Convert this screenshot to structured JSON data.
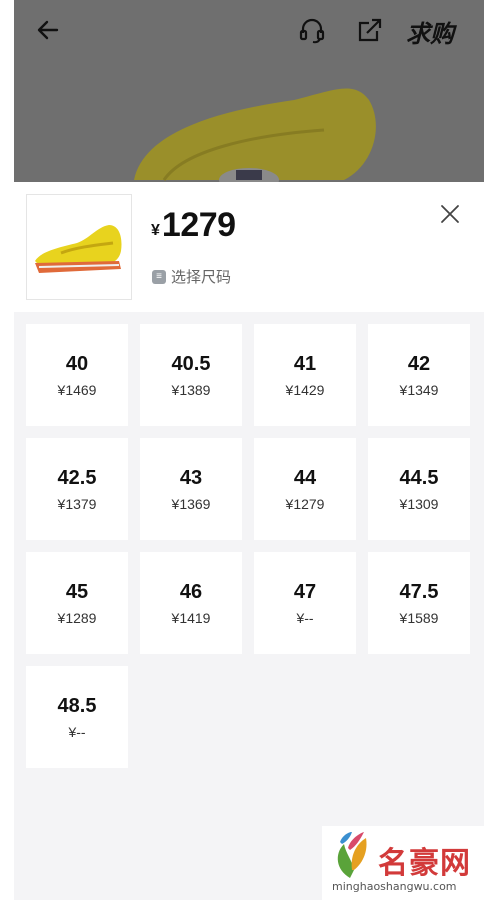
{
  "topbar": {
    "wanted_label": "求购"
  },
  "product": {
    "currency": "¥",
    "price": "1279",
    "select_hint": "选择尺码",
    "hint_icon_glyph": "≡"
  },
  "sizes": [
    {
      "size": "40",
      "price": "¥1469"
    },
    {
      "size": "40.5",
      "price": "¥1389"
    },
    {
      "size": "41",
      "price": "¥1429"
    },
    {
      "size": "42",
      "price": "¥1349"
    },
    {
      "size": "42.5",
      "price": "¥1379"
    },
    {
      "size": "43",
      "price": "¥1369"
    },
    {
      "size": "44",
      "price": "¥1279"
    },
    {
      "size": "44.5",
      "price": "¥1309"
    },
    {
      "size": "45",
      "price": "¥1289"
    },
    {
      "size": "46",
      "price": "¥1419"
    },
    {
      "size": "47",
      "price": "¥--"
    },
    {
      "size": "47.5",
      "price": "¥1589"
    },
    {
      "size": "48.5",
      "price": "¥--"
    }
  ],
  "watermark": {
    "name": "名豪网",
    "url": "minghaoshangwu.com"
  },
  "colors": {
    "dim_overlay": "#6f6f6f",
    "panel_bg": "#f4f4f6",
    "shoe_yellow": "#e8d31e",
    "sole_orange": "#e06a3a"
  }
}
